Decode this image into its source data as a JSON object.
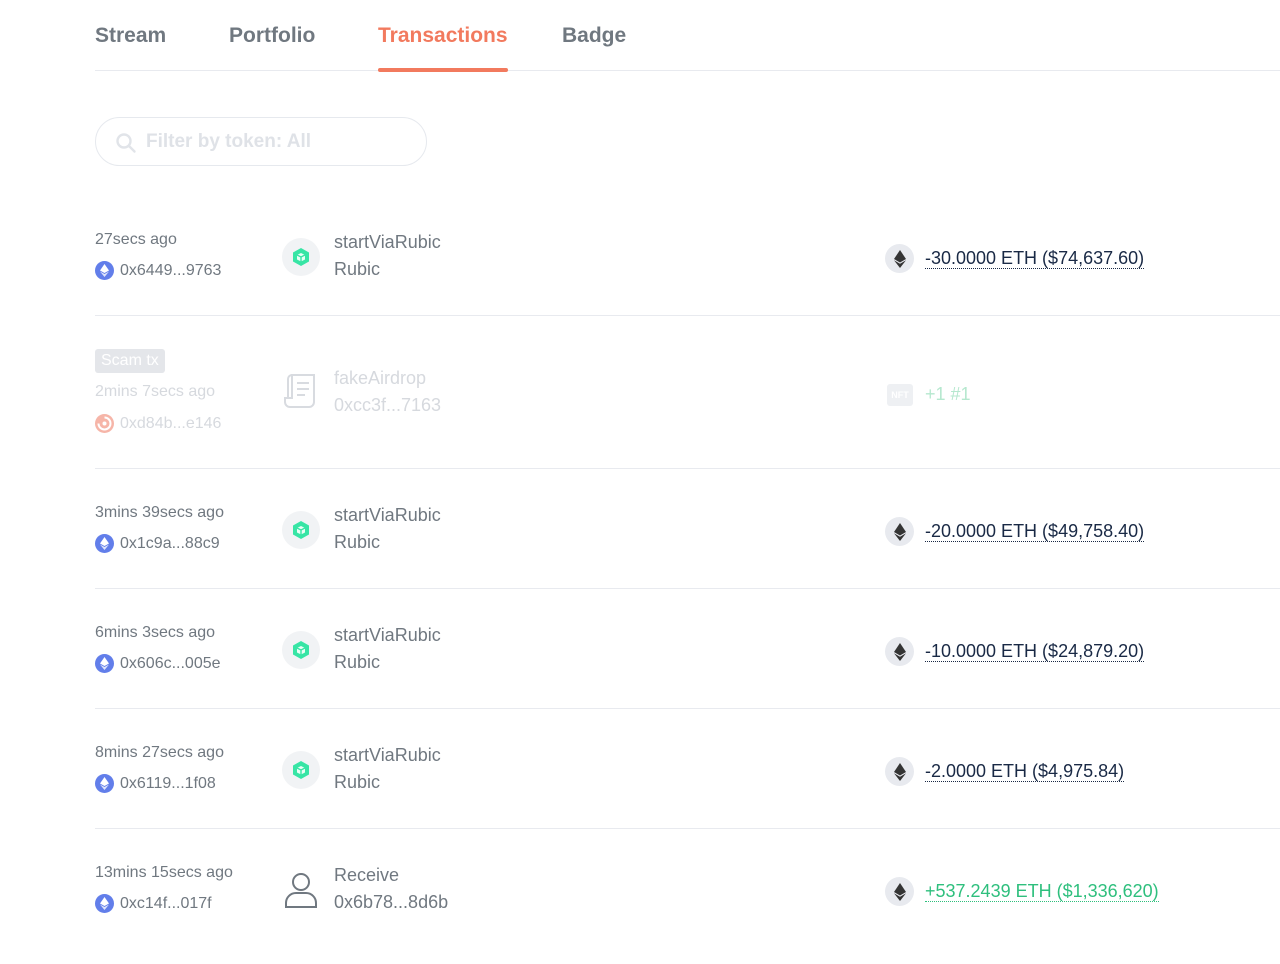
{
  "tabs": [
    {
      "label": "Stream",
      "active": false
    },
    {
      "label": "Portfolio",
      "active": false
    },
    {
      "label": "Transactions",
      "active": true
    },
    {
      "label": "Badge",
      "active": false
    }
  ],
  "search": {
    "placeholder": "Filter by token: All",
    "value": ""
  },
  "colors": {
    "accent": "#f27a5e",
    "negative_text": "#192945",
    "positive": "#2ebf7d",
    "eth_chain": "#627eea",
    "rubic_green": "#37e5a5"
  },
  "transactions": [
    {
      "time": "27secs ago",
      "hash": "0x6449...9763",
      "chain_icon": "ethereum-icon",
      "name": "startViaRubic",
      "sub": "Rubic",
      "tx_icon": "rubic-cube-icon",
      "token_icon": "eth-icon",
      "amount": "-30.0000 ETH ($74,637.60)"
    },
    {
      "scam": true,
      "badge": "Scam tx",
      "time": "2mins 7secs ago",
      "hash": "0xd84b...e146",
      "chain_icon": "scam-chain-icon",
      "name": "fakeAirdrop",
      "sub": "0xcc3f...7163",
      "tx_icon": "contract-scroll-icon",
      "token_icon": "nft-icon",
      "nft_label": "NFT",
      "amount": "+1 #1"
    },
    {
      "time": "3mins 39secs ago",
      "hash": "0x1c9a...88c9",
      "chain_icon": "ethereum-icon",
      "name": "startViaRubic",
      "sub": "Rubic",
      "tx_icon": "rubic-cube-icon",
      "token_icon": "eth-icon",
      "amount": "-20.0000 ETH ($49,758.40)"
    },
    {
      "time": "6mins 3secs ago",
      "hash": "0x606c...005e",
      "chain_icon": "ethereum-icon",
      "name": "startViaRubic",
      "sub": "Rubic",
      "tx_icon": "rubic-cube-icon",
      "token_icon": "eth-icon",
      "amount": "-10.0000 ETH ($24,879.20)"
    },
    {
      "time": "8mins 27secs ago",
      "hash": "0x6119...1f08",
      "chain_icon": "ethereum-icon",
      "name": "startViaRubic",
      "sub": "Rubic",
      "tx_icon": "rubic-cube-icon",
      "token_icon": "eth-icon",
      "amount": "-2.0000 ETH ($4,975.84)"
    },
    {
      "time": "13mins 15secs ago",
      "hash": "0xc14f...017f",
      "chain_icon": "ethereum-icon",
      "name": "Receive",
      "sub": "0x6b78...8d6b",
      "tx_icon": "user-icon",
      "token_icon": "eth-icon",
      "amount": "+537.2439 ETH ($1,336,620)",
      "positive": true
    }
  ]
}
